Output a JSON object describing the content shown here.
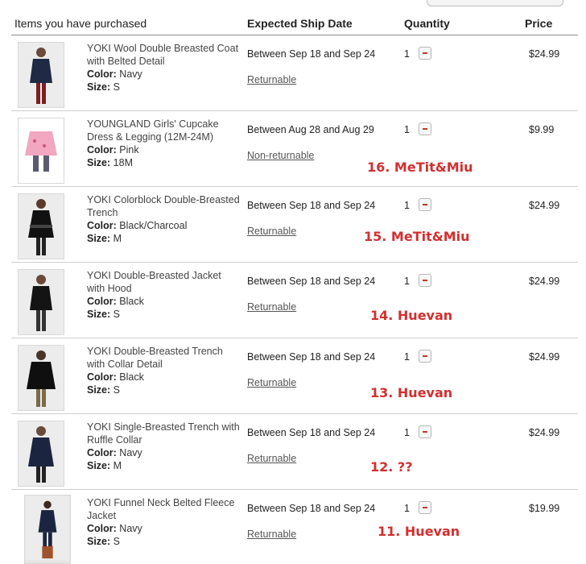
{
  "header": {
    "items": "Items you have purchased",
    "ship": "Expected Ship Date",
    "quantity": "Quantity",
    "price": "Price"
  },
  "labels": {
    "color": "Color:",
    "size": "Size:"
  },
  "items": [
    {
      "name": "YOKI Wool Double Breasted Coat with Belted Detail",
      "color": "Navy",
      "size": "S",
      "ship": "Between Sep 18 and Sep 24",
      "returnable": "Returnable",
      "quantity": "1",
      "price": "$24.99",
      "annotation": ""
    },
    {
      "name": "YOUNGLAND Girls' Cupcake Dress & Legging (12M-24M)",
      "color": "Pink",
      "size": "18M",
      "ship": "Between Aug 28 and Aug 29",
      "returnable": "Non-returnable",
      "quantity": "1",
      "price": "$9.99",
      "annotation": "16. MeTit&Miu"
    },
    {
      "name": "YOKI Colorblock Double-Breasted Trench",
      "color": "Black/Charcoal",
      "size": "M",
      "ship": "Between Sep 18 and Sep 24",
      "returnable": "Returnable",
      "quantity": "1",
      "price": "$24.99",
      "annotation": "15. MeTit&Miu"
    },
    {
      "name": "YOKI Double-Breasted Jacket with Hood",
      "color": "Black",
      "size": "S",
      "ship": "Between Sep 18 and Sep 24",
      "returnable": "Returnable",
      "quantity": "1",
      "price": "$24.99",
      "annotation": "14. Huevan"
    },
    {
      "name": "YOKI Double-Breasted Trench with Collar Detail",
      "color": "Black",
      "size": "S",
      "ship": "Between Sep 18 and Sep 24",
      "returnable": "Returnable",
      "quantity": "1",
      "price": "$24.99",
      "annotation": "13. Huevan"
    },
    {
      "name": "YOKI Single-Breasted Trench with Ruffle Collar",
      "color": "Navy",
      "size": "M",
      "ship": "Between Sep 18 and Sep 24",
      "returnable": "Returnable",
      "quantity": "1",
      "price": "$24.99",
      "annotation": "12. ??"
    },
    {
      "name": "YOKI Funnel Neck Belted Fleece Jacket",
      "color": "Navy",
      "size": "S",
      "ship": "Between Sep 18 and Sep 24",
      "returnable": "Returnable",
      "quantity": "1",
      "price": "$19.99",
      "annotation": "11. Huevan"
    }
  ],
  "colors": {
    "annotation": "#d32f2f",
    "minus": "#c0392b"
  }
}
